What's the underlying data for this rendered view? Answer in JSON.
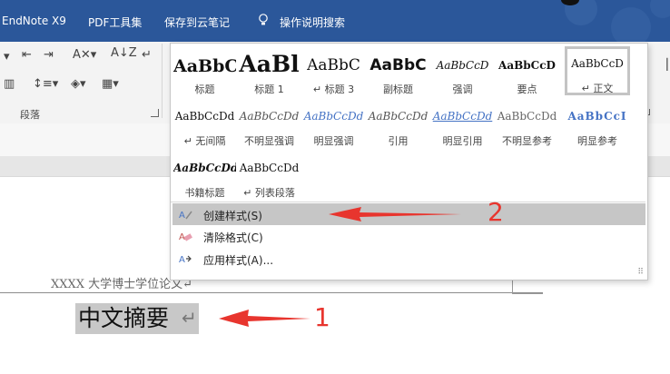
{
  "tabs": [
    "EndNote X9",
    "PDF工具集",
    "保存到云笔记",
    "操作说明搜索"
  ],
  "ribbon": {
    "paragraph_group": "段落"
  },
  "gallery": {
    "styles": [
      {
        "preview": "AaBbC",
        "label": "标题"
      },
      {
        "preview": "AaBl",
        "label": "标题 1"
      },
      {
        "preview": "AaBbC",
        "label": "↵ 标题 3"
      },
      {
        "preview": "AaBbC",
        "label": "副标题"
      },
      {
        "preview": "AaBbCcD",
        "label": "强调"
      },
      {
        "preview": "AaBbCcD",
        "label": "要点"
      },
      {
        "preview": "AaBbCcD",
        "label": "↵ 正文"
      },
      {
        "preview": "AaBbCcDd",
        "label": "↵ 无间隔"
      },
      {
        "preview": "AaBbCcDd",
        "label": "不明显强调"
      },
      {
        "preview": "AaBbCcDd",
        "label": "明显强调"
      },
      {
        "preview": "AaBbCcDd",
        "label": "引用"
      },
      {
        "preview": "AaBbCcDd",
        "label": "明显引用"
      },
      {
        "preview": "AaBbCcDd",
        "label": "不明显参考"
      },
      {
        "preview": "AaBbCcI",
        "label": "明显参考"
      },
      {
        "preview": "AaBbCcDd",
        "label": "书籍标题"
      },
      {
        "preview": "AaBbCcDd",
        "label": "↵ 列表段落"
      }
    ],
    "menu": [
      {
        "label": "创建样式(S)"
      },
      {
        "label": "清除格式(C)"
      },
      {
        "label": "应用样式(A)..."
      }
    ]
  },
  "document": {
    "header": "XXXX 大学博士学位论文↵",
    "heading": "中文摘要",
    "pilcrow": "↵"
  },
  "annotations": {
    "one": "1",
    "two": "2"
  },
  "colors": {
    "titlebar": "#2b579a",
    "arrow": "#e8352e",
    "highlight": "#c6c6c6"
  }
}
